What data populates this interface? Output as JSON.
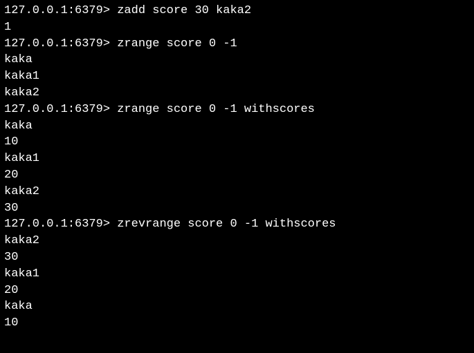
{
  "session": {
    "prompt": "127.0.0.1:6379> ",
    "entries": [
      {
        "type": "cmdline",
        "command": "zadd score 30 kaka2"
      },
      {
        "type": "out",
        "text": "1"
      },
      {
        "type": "cmdline",
        "command": "zrange score 0 -1"
      },
      {
        "type": "out",
        "text": "kaka"
      },
      {
        "type": "out",
        "text": "kaka1"
      },
      {
        "type": "out",
        "text": "kaka2"
      },
      {
        "type": "cmdline",
        "command": "zrange score 0 -1 withscores"
      },
      {
        "type": "out",
        "text": "kaka"
      },
      {
        "type": "out",
        "text": "10"
      },
      {
        "type": "out",
        "text": "kaka1"
      },
      {
        "type": "out",
        "text": "20"
      },
      {
        "type": "out",
        "text": "kaka2"
      },
      {
        "type": "out",
        "text": "30"
      },
      {
        "type": "cmdline",
        "command": "zrevrange score 0 -1 withscores"
      },
      {
        "type": "out",
        "text": "kaka2"
      },
      {
        "type": "out",
        "text": "30"
      },
      {
        "type": "out",
        "text": "kaka1"
      },
      {
        "type": "out",
        "text": "20"
      },
      {
        "type": "out",
        "text": "kaka"
      },
      {
        "type": "out",
        "text": "10"
      }
    ]
  }
}
